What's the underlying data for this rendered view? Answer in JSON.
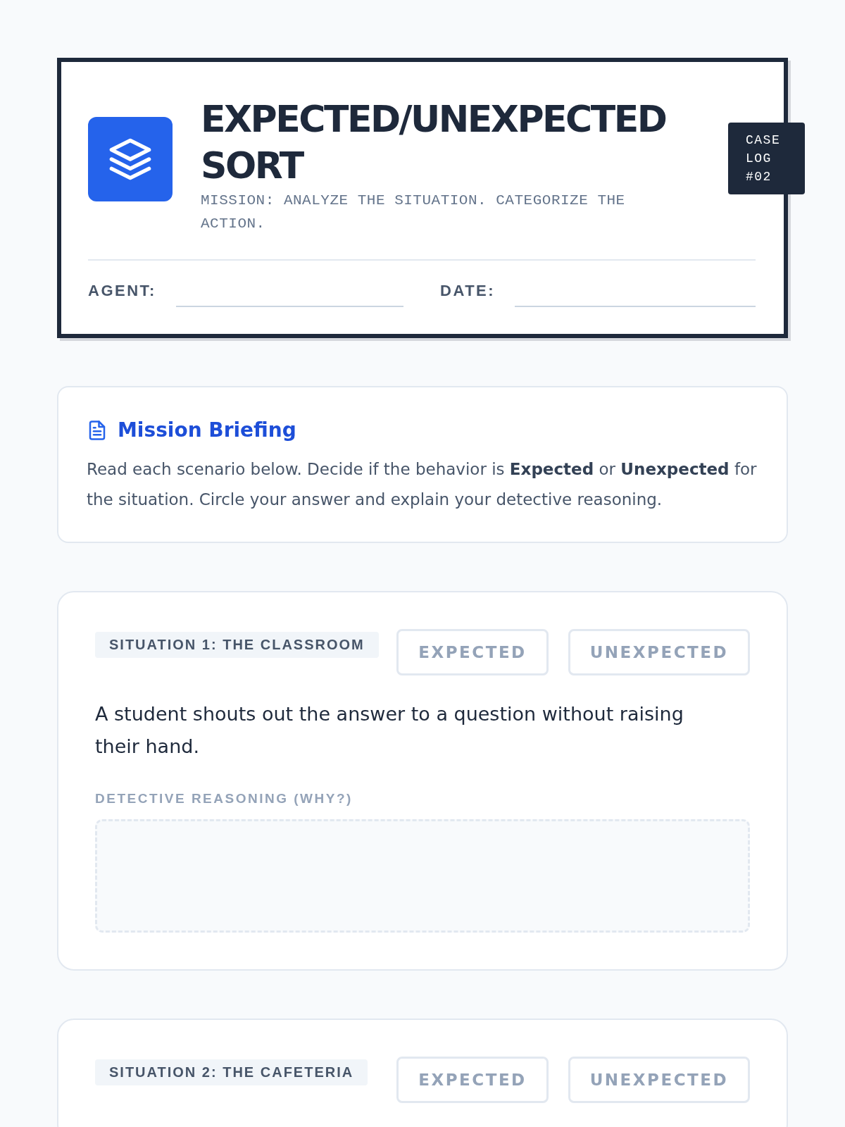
{
  "header": {
    "title": "EXPECTED/UNEXPECTED SORT",
    "subtitle": "MISSION: ANALYZE THE SITUATION. CATEGORIZE THE ACTION.",
    "badge": "CASE LOG #02",
    "fields": [
      {
        "label": "AGENT:"
      },
      {
        "label": "DATE:"
      }
    ]
  },
  "briefing": {
    "title": "Mission Briefing",
    "text": "Read each scenario below. Decide if the behavior is **Expected** or **Unexpected** for the situation. Circle your answer and explain your detective reasoning."
  },
  "situations": [
    {
      "tag": "SITUATION 1: THE CLASSROOM",
      "options": [
        {
          "label": "EXPECTED",
          "selected": false
        },
        {
          "label": "UNEXPECTED",
          "selected": false
        }
      ],
      "scenario": "A student shouts out the answer to a question without raising their hand.",
      "reasoning_label": "DETECTIVE REASONING (WHY?)"
    },
    {
      "tag": "SITUATION 2: THE CAFETERIA",
      "options": [
        {
          "label": "EXPECTED",
          "selected": false
        },
        {
          "label": "UNEXPECTED",
          "selected": false
        }
      ]
    }
  ]
}
